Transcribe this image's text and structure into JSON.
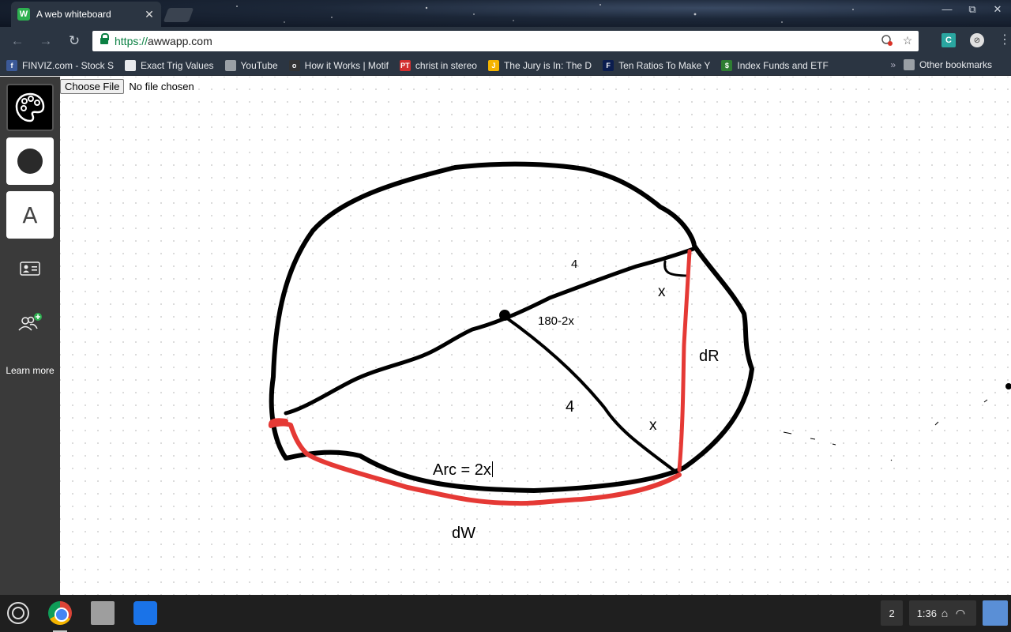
{
  "browser": {
    "tab": {
      "title": "A web whiteboard",
      "favicon_letter": "W",
      "close_glyph": "✕"
    },
    "window_controls": {
      "minimize": "—",
      "maximize": "⧉",
      "close": "✕"
    },
    "nav": {
      "back": "←",
      "forward": "→",
      "reload": "↻"
    },
    "url": {
      "scheme": "https://",
      "host": "awwapp.com"
    },
    "extensions": {
      "c_label": "C"
    },
    "bookmarks": [
      {
        "label": "FINVIZ.com - Stock S",
        "icon": "facebook-icon",
        "icon_glyph": "f",
        "color": "#3b5998"
      },
      {
        "label": "Exact Trig Values",
        "icon": "page-icon",
        "icon_glyph": "",
        "color": "#e8eaed"
      },
      {
        "label": "YouTube",
        "icon": "folder-icon",
        "icon_glyph": "",
        "color": "#9aa0a6"
      },
      {
        "label": "How it Works | Motif",
        "icon": "motif-icon",
        "icon_glyph": "o",
        "color": "#333333"
      },
      {
        "label": "christ in stereo",
        "icon": "pt-icon",
        "icon_glyph": "PT",
        "color": "#d32f2f"
      },
      {
        "label": "The Jury is In: The D",
        "icon": "jury-icon",
        "icon_glyph": "J",
        "color": "#f4b400"
      },
      {
        "label": "Ten Ratios To Make Y",
        "icon": "forbes-icon",
        "icon_glyph": "F",
        "color": "#0b1d4f"
      },
      {
        "label": "Index Funds and ETF",
        "icon": "dollar-icon",
        "icon_glyph": "$",
        "color": "#2e7d32"
      }
    ],
    "bookmarks_more": "»",
    "other_bookmarks": "Other bookmarks"
  },
  "app": {
    "tools": [
      {
        "name": "palette-tool",
        "icon": "palette-icon"
      },
      {
        "name": "brush-tool",
        "icon": "brush-dot-icon"
      },
      {
        "name": "text-tool",
        "icon": "text-icon",
        "glyph": "A"
      },
      {
        "name": "card-tool",
        "icon": "id-card-icon"
      },
      {
        "name": "invite-tool",
        "icon": "add-users-icon"
      }
    ],
    "learn_more": "Learn more",
    "file_input": {
      "button": "Choose File",
      "status": "No file chosen"
    }
  },
  "whiteboard": {
    "labels": {
      "top_radius": "4",
      "angle_top": "x",
      "center_angle": "180-2x",
      "chord": "dR",
      "lower_radius": "4",
      "angle_bottom": "x",
      "arc": "Arc = 2x",
      "red_arc": "dW"
    },
    "stroke_colors": {
      "black": "#000000",
      "red": "#e53935"
    }
  },
  "shelf": {
    "apps": [
      "chrome-icon",
      "web-store-icon",
      "files-icon"
    ],
    "notifications": "2",
    "time": "1:36"
  }
}
